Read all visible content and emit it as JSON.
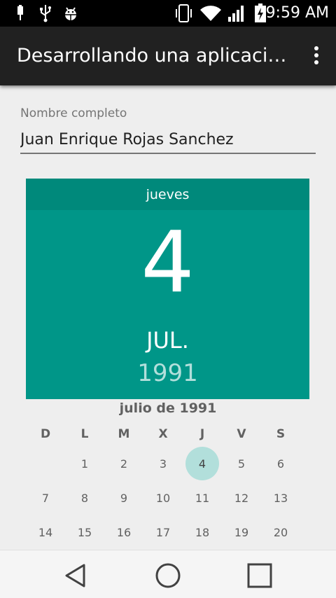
{
  "status_bar": {
    "time": "9:59 AM",
    "icons": [
      "usb-icon",
      "usb-debug-icon",
      "android-debug-icon",
      "vibrate-icon",
      "wifi-icon",
      "signal-icon",
      "battery-charging-icon"
    ]
  },
  "app_bar": {
    "title": "Desarrollando una aplicaci…",
    "overflow_icon": "more-vert-icon"
  },
  "form": {
    "name_label": "Nombre completo",
    "name_value": "Juan Enrique Rojas Sanchez"
  },
  "date_picker": {
    "weekday": "jueves",
    "day": "4",
    "month": "JUL.",
    "year": "1991",
    "month_title": "julio de 1991",
    "day_headers": [
      "D",
      "L",
      "M",
      "X",
      "J",
      "V",
      "S"
    ],
    "selected_day": "4",
    "weeks": [
      [
        "",
        "1",
        "2",
        "3",
        "4",
        "5",
        "6"
      ],
      [
        "7",
        "8",
        "9",
        "10",
        "11",
        "12",
        "13"
      ],
      [
        "14",
        "15",
        "16",
        "17",
        "18",
        "19",
        "20"
      ]
    ]
  },
  "nav_bar": {
    "back_icon": "back-icon",
    "home_icon": "home-icon",
    "recents_icon": "recents-icon"
  },
  "colors": {
    "header": "#009688",
    "header_dark": "#00897b",
    "selected": "#b2dfdb",
    "app_bar": "#212121"
  }
}
